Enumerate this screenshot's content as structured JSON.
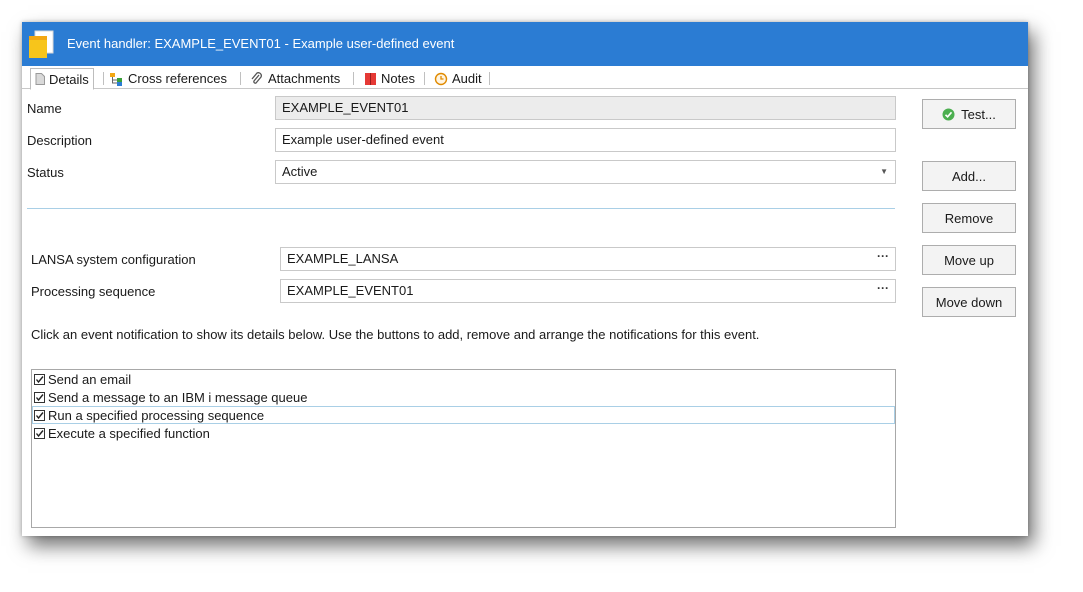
{
  "window": {
    "title": "Event handler: EXAMPLE_EVENT01 - Example user-defined event"
  },
  "tabs": [
    {
      "label": "Details",
      "icon": "document-icon",
      "active": true
    },
    {
      "label": "Cross references",
      "icon": "tree-icon",
      "active": false
    },
    {
      "label": "Attachments",
      "icon": "paperclip-icon",
      "active": false
    },
    {
      "label": "Notes",
      "icon": "book-icon",
      "active": false
    },
    {
      "label": "Audit",
      "icon": "history-icon",
      "active": false
    }
  ],
  "form": {
    "name_label": "Name",
    "name_value": "EXAMPLE_EVENT01",
    "description_label": "Description",
    "description_value": "Example user-defined event",
    "status_label": "Status",
    "status_value": "Active",
    "lansa_label": "LANSA system configuration",
    "lansa_value": "EXAMPLE_LANSA",
    "sequence_label": "Processing sequence",
    "sequence_value": "EXAMPLE_EVENT01",
    "browse_glyph": "···"
  },
  "buttons": {
    "test": "Test...",
    "add": "Add...",
    "remove": "Remove",
    "move_up": "Move up",
    "move_down": "Move down"
  },
  "hint": "Click an event notification to show its details below.  Use the buttons to add, remove and arrange the notifications for this event.",
  "notifications": [
    {
      "label": "Send an email",
      "checked": true
    },
    {
      "label": "Send a message to an IBM i message queue",
      "checked": true
    },
    {
      "label": "Run a specified processing sequence",
      "checked": true,
      "focused": true
    },
    {
      "label": "Execute a specified function",
      "checked": true
    }
  ],
  "colors": {
    "titlebar": "#2b7cd3",
    "accent_divider": "#a9cfe6",
    "test_icon": "#4caf50"
  }
}
